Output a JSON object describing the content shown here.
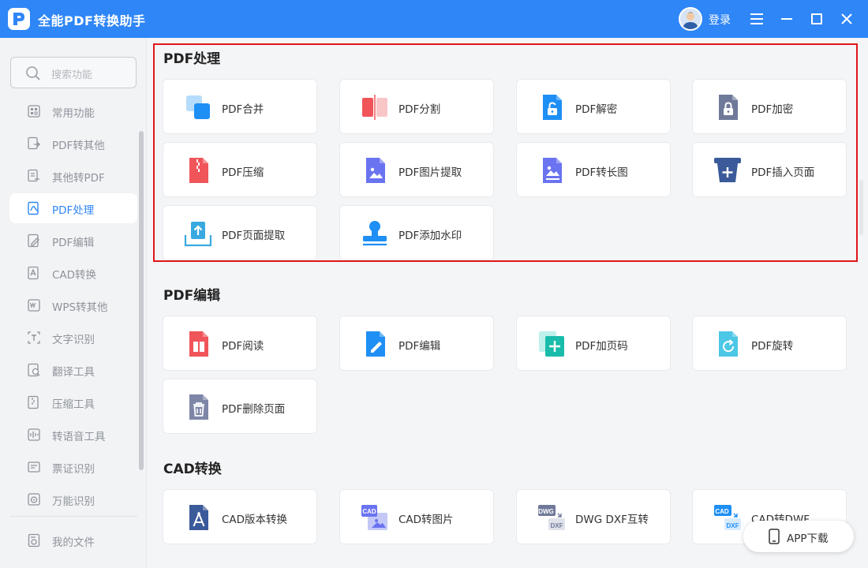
{
  "app": {
    "title": "全能PDF转换助手",
    "login_label": "登录",
    "accent_color": "#2f86f6"
  },
  "search": {
    "placeholder": "搜索功能"
  },
  "sidebar": {
    "items": [
      {
        "label": "常用功能",
        "icon": "common-functions-icon",
        "active": false
      },
      {
        "label": "PDF转其他",
        "icon": "pdf-to-other-icon",
        "active": false
      },
      {
        "label": "其他转PDF",
        "icon": "other-to-pdf-icon",
        "active": false
      },
      {
        "label": "PDF处理",
        "icon": "pdf-process-icon",
        "active": true
      },
      {
        "label": "PDF编辑",
        "icon": "pdf-edit-icon",
        "active": false
      },
      {
        "label": "CAD转换",
        "icon": "cad-convert-icon",
        "active": false
      },
      {
        "label": "WPS转其他",
        "icon": "wps-convert-icon",
        "active": false
      },
      {
        "label": "文字识别",
        "icon": "text-recognition-icon",
        "active": false
      },
      {
        "label": "翻译工具",
        "icon": "translate-icon",
        "active": false
      },
      {
        "label": "压缩工具",
        "icon": "compress-icon",
        "active": false
      },
      {
        "label": "转语音工具",
        "icon": "speech-icon",
        "active": false
      },
      {
        "label": "票证识别",
        "icon": "ticket-recognition-icon",
        "active": false
      },
      {
        "label": "万能识别",
        "icon": "universal-recognition-icon",
        "active": false
      }
    ],
    "my_files_label": "我的文件"
  },
  "sections": [
    {
      "title": "PDF处理",
      "cards": [
        {
          "label": "PDF合并",
          "icon": "pdf-merge-icon"
        },
        {
          "label": "PDF分割",
          "icon": "pdf-split-icon"
        },
        {
          "label": "PDF解密",
          "icon": "pdf-decrypt-icon"
        },
        {
          "label": "PDF加密",
          "icon": "pdf-encrypt-icon"
        },
        {
          "label": "PDF压缩",
          "icon": "pdf-compress-icon"
        },
        {
          "label": "PDF图片提取",
          "icon": "pdf-image-extract-icon"
        },
        {
          "label": "PDF转长图",
          "icon": "pdf-long-image-icon"
        },
        {
          "label": "PDF插入页面",
          "icon": "pdf-insert-page-icon"
        },
        {
          "label": "PDF页面提取",
          "icon": "pdf-page-extract-icon"
        },
        {
          "label": "PDF添加水印",
          "icon": "pdf-watermark-icon"
        }
      ]
    },
    {
      "title": "PDF编辑",
      "cards": [
        {
          "label": "PDF阅读",
          "icon": "pdf-read-icon"
        },
        {
          "label": "PDF编辑",
          "icon": "pdf-edit-doc-icon"
        },
        {
          "label": "PDF加页码",
          "icon": "pdf-page-number-icon"
        },
        {
          "label": "PDF旋转",
          "icon": "pdf-rotate-icon"
        },
        {
          "label": "PDF删除页面",
          "icon": "pdf-delete-page-icon"
        }
      ]
    },
    {
      "title": "CAD转换",
      "cards": [
        {
          "label": "CAD版本转换",
          "icon": "cad-version-icon"
        },
        {
          "label": "CAD转图片",
          "icon": "cad-to-image-icon",
          "badge": "CAD"
        },
        {
          "label": "DWG DXF互转",
          "icon": "dwg-dxf-icon",
          "badge": "DWG",
          "badge2": "DXF"
        },
        {
          "label": "CAD转DWF",
          "icon": "cad-to-dwf-icon",
          "badge": "CAD",
          "badge2": "DXF"
        }
      ]
    }
  ],
  "app_download_label": "APP下载",
  "colors": {
    "highlight_border": "#e0161b",
    "card_bg": "#ffffff",
    "sidebar_active_text": "#2f86f6"
  }
}
